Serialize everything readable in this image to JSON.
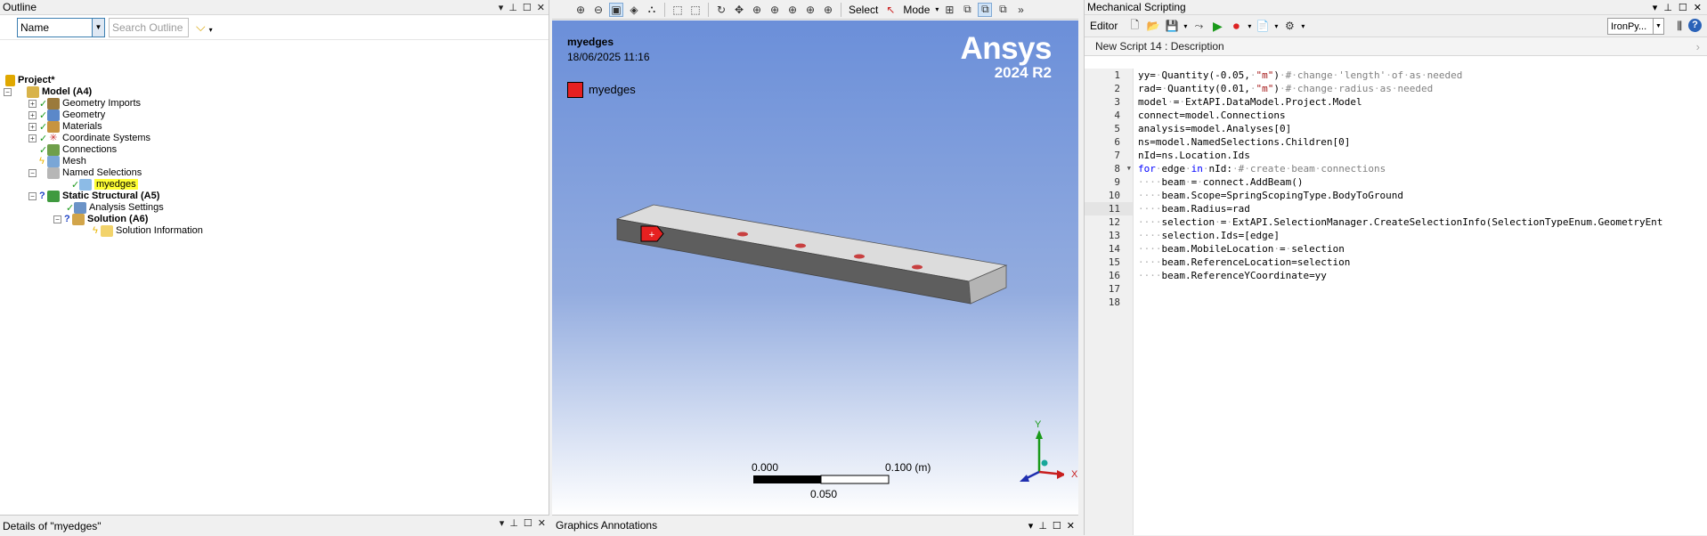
{
  "outline": {
    "title": "Outline",
    "name_filter": "Name",
    "search_placeholder": "Search Outline",
    "tree": [
      {
        "label": "Project*"
      },
      {
        "label": "Model (A4)"
      },
      {
        "label": "Geometry Imports"
      },
      {
        "label": "Geometry"
      },
      {
        "label": "Materials"
      },
      {
        "label": "Coordinate Systems"
      },
      {
        "label": "Connections"
      },
      {
        "label": "Mesh"
      },
      {
        "label": "Named Selections"
      },
      {
        "label": "myedges"
      },
      {
        "label": "Static Structural (A5)"
      },
      {
        "label": "Analysis Settings"
      },
      {
        "label": "Solution (A6)"
      },
      {
        "label": "Solution Information"
      }
    ]
  },
  "details": {
    "title": "Details of \"myedges\""
  },
  "graphics": {
    "toolbar": {
      "select_label": "Select",
      "mode_label": "Mode"
    },
    "viewport_title": "myedges",
    "timestamp": "18/06/2025 11:16",
    "legend_label": "myedges",
    "legend_color": "#e62020",
    "brand_name": "Ansys",
    "brand_version": "2024 R2",
    "scale": {
      "left": "0.000",
      "right": "0.100 (m)",
      "mid": "0.050"
    },
    "triad": {
      "x": "X",
      "y": "Y"
    },
    "annotations_title": "Graphics Annotations"
  },
  "scripting": {
    "title": "Mechanical Scripting",
    "editor_label": "Editor",
    "language": "IronPy...",
    "description": "New Script 14 : Description",
    "current_line": 11,
    "lines": [
      "yy= Quantity(-0.05, \"m\") # change 'length' of as needed",
      "rad= Quantity(0.01, \"m\") # change radius as needed",
      "model = ExtAPI.DataModel.Project.Model",
      "connect=model.Connections",
      "analysis=model.Analyses[0]",
      "ns=model.NamedSelections.Children[0]",
      "nId=ns.Location.Ids",
      "for edge in nId: # create beam connections",
      "    beam = connect.AddBeam()",
      "    beam.Scope=SpringScopingType.BodyToGround",
      "    beam.Radius=rad",
      "    selection = ExtAPI.SelectionManager.CreateSelectionInfo(SelectionTypeEnum.GeometryEnt",
      "    selection.Ids=[edge]",
      "    beam.MobileLocation = selection",
      "    beam.ReferenceLocation=selection",
      "    beam.ReferenceYCoordinate=yy",
      "",
      ""
    ]
  }
}
